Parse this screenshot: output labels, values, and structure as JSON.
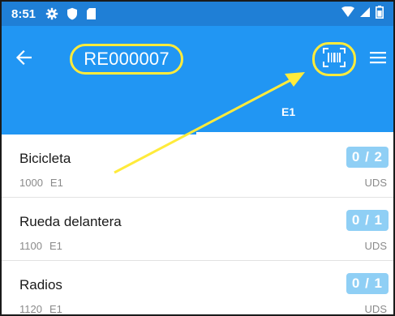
{
  "status_bar": {
    "time": "8:51",
    "icons": [
      "gear-icon",
      "shield-icon",
      "sd-card-icon"
    ],
    "right_icons": [
      "wifi-icon",
      "signal-icon",
      "battery-icon"
    ]
  },
  "app_bar": {
    "title": "RE000007",
    "back_icon": "arrow-back-icon",
    "scan_icon": "barcode-scan-icon",
    "menu_icon": "menu-icon"
  },
  "tabs": [
    {
      "label": "E1",
      "selected": true
    }
  ],
  "items": [
    {
      "name": "Bicicleta",
      "code": "1000",
      "location": "E1",
      "qty": "0 / 2",
      "unit": "UDS"
    },
    {
      "name": "Rueda delantera",
      "code": "1100",
      "location": "E1",
      "qty": "0 / 1",
      "unit": "UDS"
    },
    {
      "name": "Radios",
      "code": "1120",
      "location": "E1",
      "qty": "0 / 1",
      "unit": "UDS"
    }
  ],
  "colors": {
    "primary": "#2196f3",
    "status_bar": "#1f7fd6",
    "highlight": "#ffeb3b",
    "qty_badge": "#8fcff5"
  }
}
